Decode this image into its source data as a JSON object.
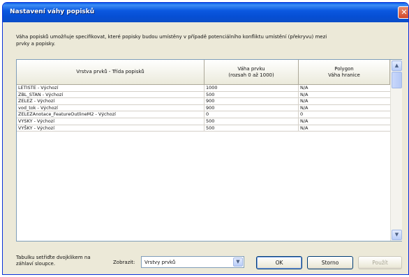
{
  "window": {
    "title": "Nastavení váhy popisků",
    "close_glyph": "✕"
  },
  "description": "Váha popisků umožňuje specifikovat, které popisky budou umístěny v případě potenciálního konfliktu umístění (překryvu) mezi prvky a popisky.",
  "table": {
    "headers": {
      "layer_class": "Vrstva prvků - Třída popisků",
      "feature_weight_line1": "Váha prvku",
      "feature_weight_line2": "(rozsah 0 až 1000)",
      "polygon_line1": "Polygon",
      "polygon_line2": "Váha hranice"
    },
    "rows": [
      {
        "layer": "LETISTE - Výchozí",
        "weight": "1000",
        "boundary": "N/A"
      },
      {
        "layer": "ZBL_STAN - Výchozí",
        "weight": "500",
        "boundary": "N/A"
      },
      {
        "layer": "ZELEZ - Výchozí",
        "weight": "900",
        "boundary": "N/A"
      },
      {
        "layer": "vod_tok - Výchozí",
        "weight": "900",
        "boundary": "N/A"
      },
      {
        "layer": "ZELEZAnotace_FeatureOutlineM2 - Výchozí",
        "weight": "0",
        "boundary": "0"
      },
      {
        "layer": "VYSKY - Výchozí",
        "weight": "500",
        "boundary": "N/A"
      },
      {
        "layer": "VYŠKY - Výchozí",
        "weight": "500",
        "boundary": "N/A"
      }
    ],
    "scroll_up_glyph": "▲",
    "scroll_down_glyph": "▼"
  },
  "footer": {
    "hint": "Tabulku setřiďte dvojklikem na záhlaví sloupce.",
    "show_label": "Zobrazit:",
    "show_value": "Vrstvy prvků",
    "dropdown_glyph": "▼",
    "ok_label": "OK",
    "cancel_label": "Storno",
    "apply_label": "Použít"
  }
}
